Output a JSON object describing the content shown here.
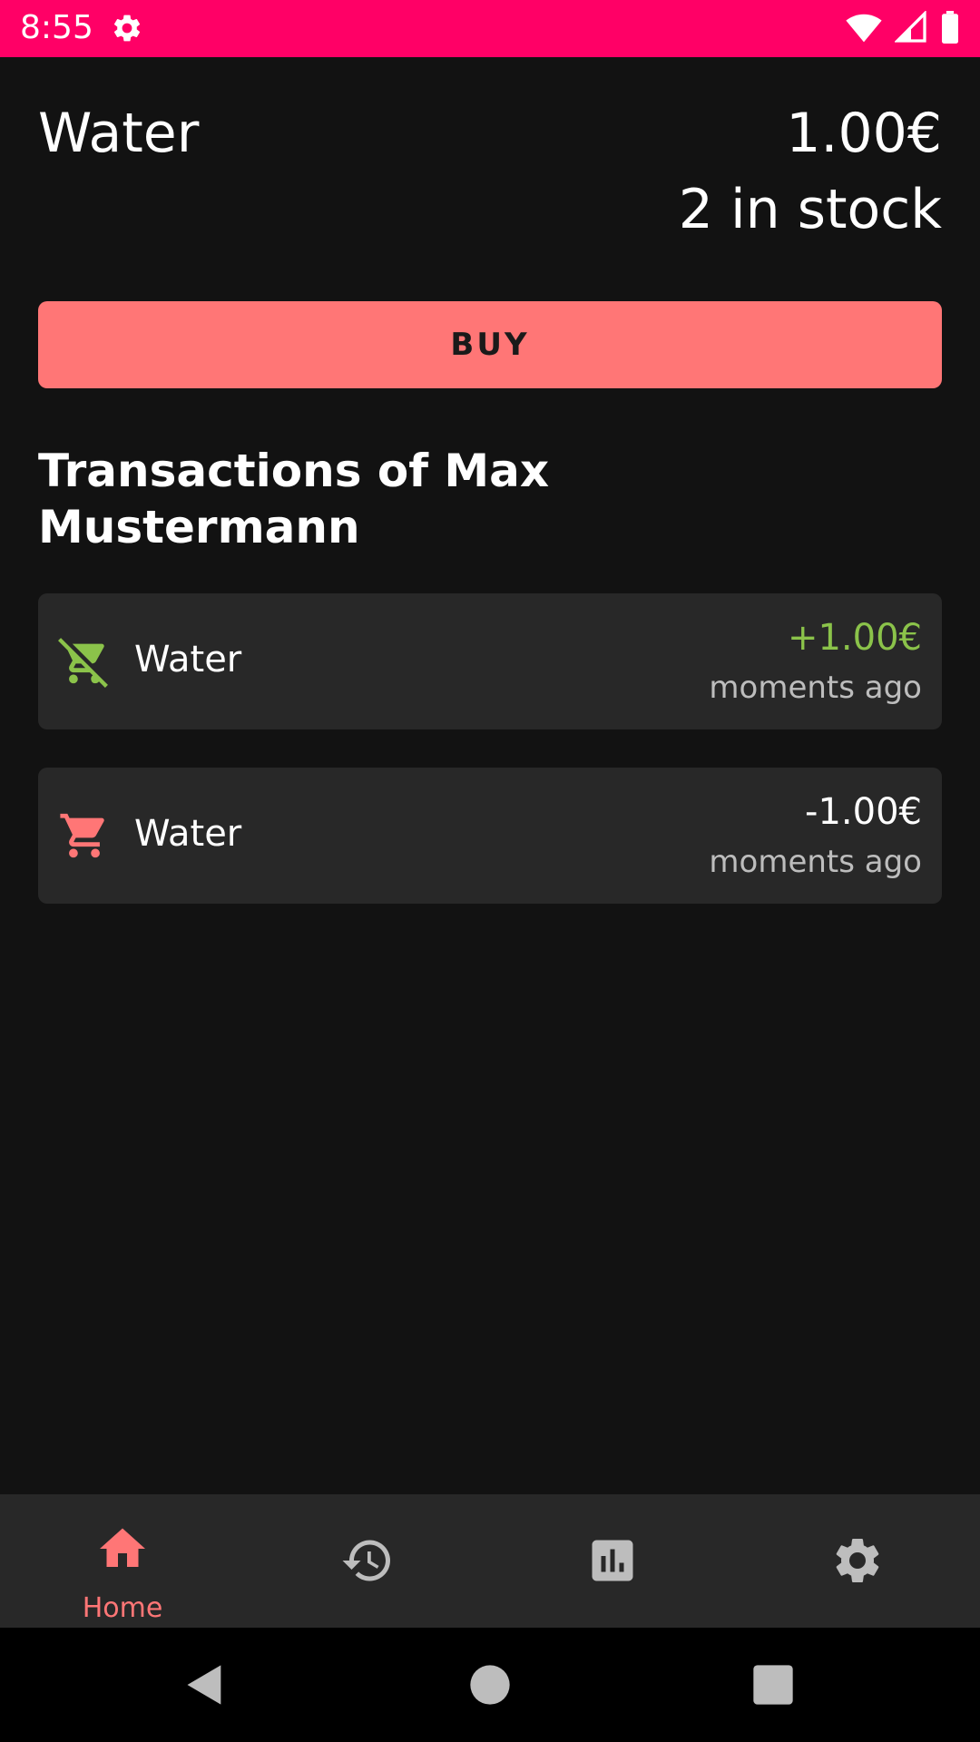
{
  "status_bar": {
    "time": "8:55",
    "icons": [
      "gear-icon",
      "wifi-icon",
      "signal-icon",
      "battery-icon"
    ],
    "color": "#ff0066"
  },
  "product": {
    "name": "Water",
    "price": "1.00€",
    "stock": "2 in stock"
  },
  "buy_button": {
    "label": "BUY",
    "color": "#ff7676"
  },
  "transactions": {
    "title": "Transactions of Max Mustermann",
    "items": [
      {
        "icon": "remove-shopping-cart-icon",
        "name": "Water",
        "amount": "+1.00€",
        "time": "moments ago",
        "amount_color": "#8bc34a"
      },
      {
        "icon": "shopping-cart-icon",
        "name": "Water",
        "amount": "-1.00€",
        "time": "moments ago",
        "amount_color": "#ffffff"
      }
    ]
  },
  "bottom_nav": {
    "items": [
      {
        "icon": "home-icon",
        "label": "Home",
        "active": true
      },
      {
        "icon": "history-icon",
        "label": "",
        "active": false
      },
      {
        "icon": "bar-chart-icon",
        "label": "",
        "active": false
      },
      {
        "icon": "settings-icon",
        "label": "",
        "active": false
      }
    ],
    "active_color": "#ff7676",
    "inactive_color": "#bdbdbd"
  },
  "system_nav": {
    "icons": [
      "back-icon",
      "home-circle-icon",
      "recents-icon"
    ]
  }
}
